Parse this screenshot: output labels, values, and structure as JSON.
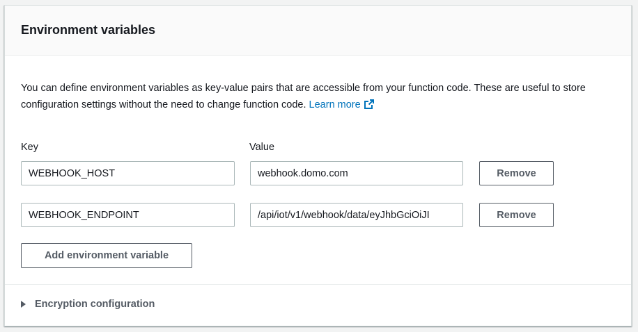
{
  "section": {
    "title": "Environment variables",
    "description": "You can define environment variables as key-value pairs that are accessible from your function code. These are useful to store configuration settings without the need to change function code.",
    "learn_more": "Learn more",
    "learn_more_icon": "external-link-icon",
    "key_label": "Key",
    "value_label": "Value",
    "variables": [
      {
        "key": "WEBHOOK_HOST",
        "value": "webhook.domo.com",
        "remove_label": "Remove"
      },
      {
        "key": "WEBHOOK_ENDPOINT",
        "value": "/api/iot/v1/webhook/data/eyJhbGciOiJI",
        "remove_label": "Remove"
      }
    ],
    "add_label": "Add environment variable"
  },
  "encryption": {
    "label": "Encryption configuration",
    "icon": "caret-right-icon",
    "expanded": false
  },
  "colors": {
    "link": "#0073bb",
    "button_text": "#545b64",
    "input_border": "#aab7b8"
  }
}
